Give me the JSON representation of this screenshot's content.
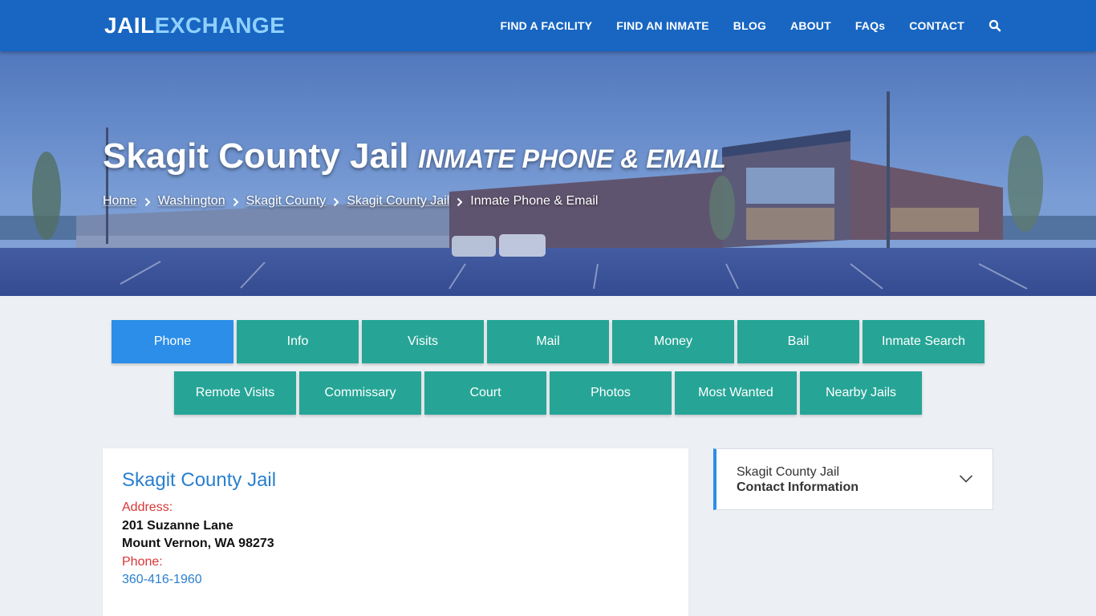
{
  "brand": {
    "part1": "JAIL",
    "part2": "EXCHANGE"
  },
  "nav": {
    "items": [
      "FIND A FACILITY",
      "FIND AN INMATE",
      "BLOG",
      "ABOUT",
      "FAQs",
      "CONTACT"
    ],
    "search_icon": "search-icon"
  },
  "hero": {
    "title": "Skagit County Jail",
    "subtitle": "INMATE PHONE & EMAIL",
    "breadcrumbs": [
      "Home",
      "Washington",
      "Skagit County",
      "Skagit County Jail",
      "Inmate Phone & Email"
    ]
  },
  "tabs": {
    "row1": [
      "Phone",
      "Info",
      "Visits",
      "Mail",
      "Money",
      "Bail",
      "Inmate Search"
    ],
    "row2": [
      "Remote Visits",
      "Commissary",
      "Court",
      "Photos",
      "Most Wanted",
      "Nearby Jails"
    ],
    "active": "Phone"
  },
  "facility": {
    "name": "Skagit County Jail",
    "address_label": "Address:",
    "address_line1": "201 Suzanne Lane",
    "address_line2": "Mount Vernon, WA 98273",
    "phone_label": "Phone:",
    "phone": "360-416-1960"
  },
  "sidebar": {
    "line1": "Skagit County Jail",
    "line2": "Contact Information"
  },
  "colors": {
    "header": "#1866c2",
    "tab": "#26a596",
    "tab_active": "#2c8ee8",
    "link": "#2a7fce",
    "label": "#d93636"
  }
}
